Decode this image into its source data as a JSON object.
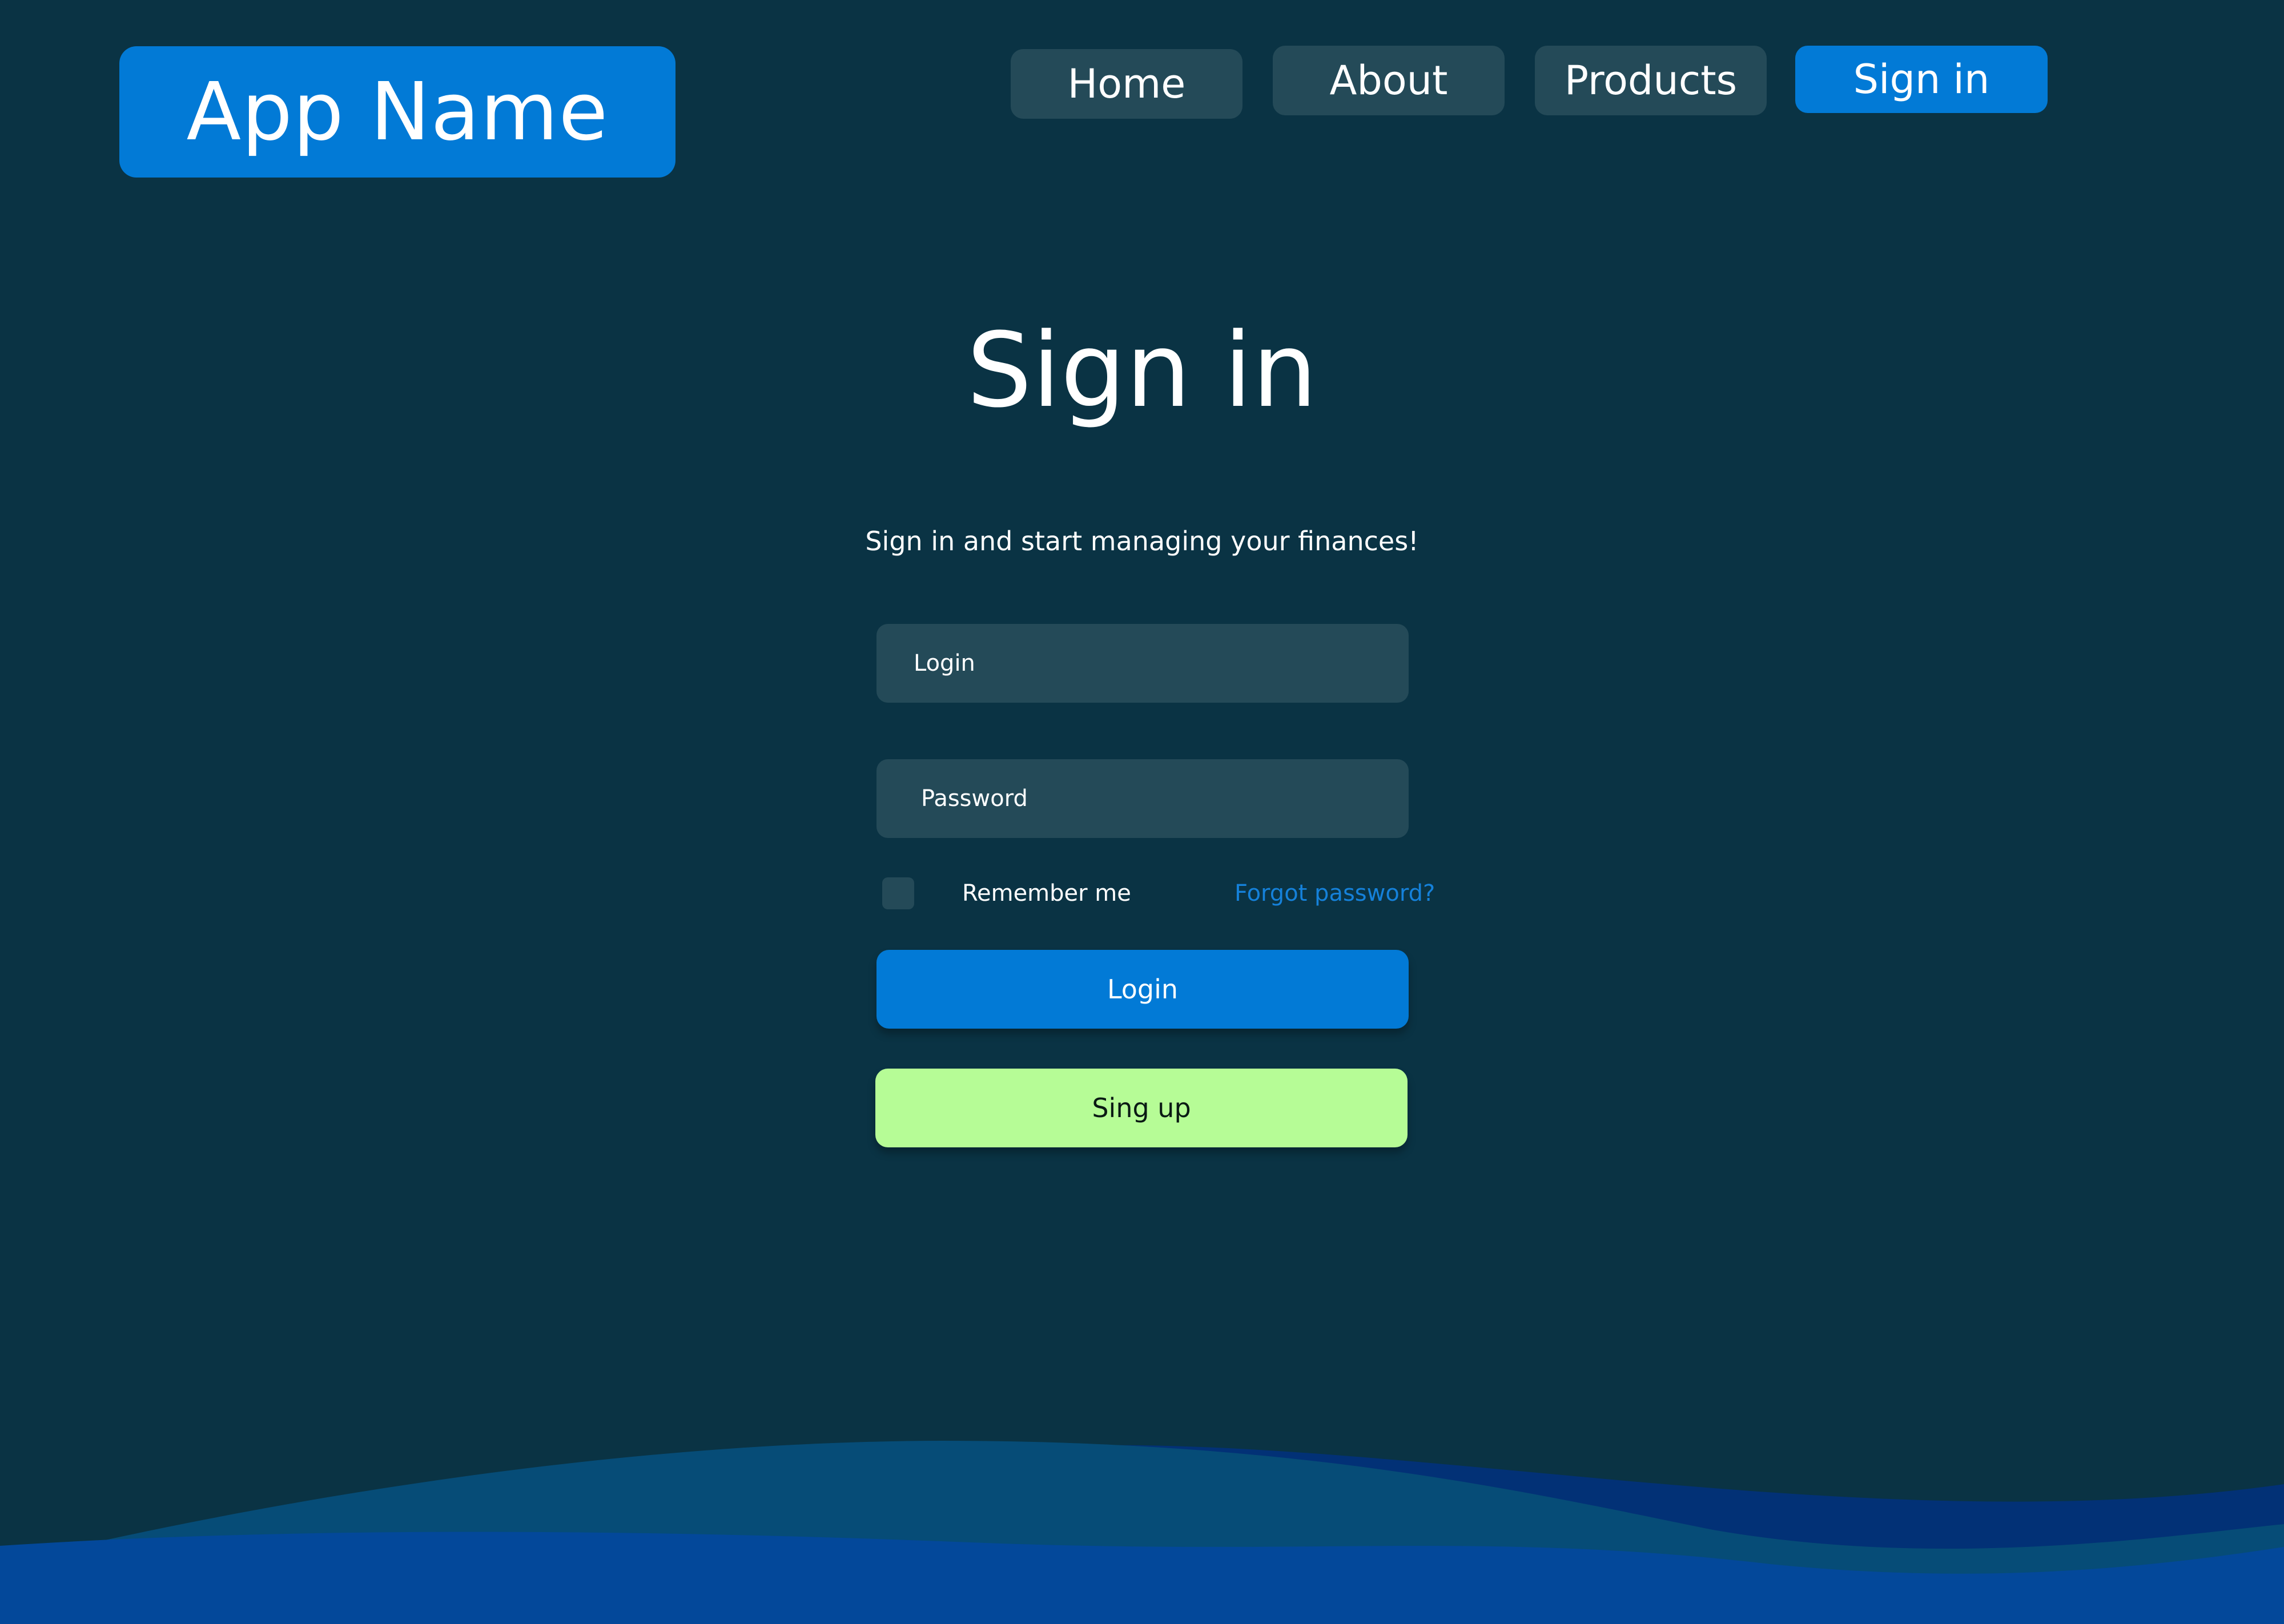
{
  "header": {
    "app_name": "App Name",
    "nav": {
      "home": "Home",
      "about": "About",
      "products": "Products",
      "sign_in": "Sign in"
    }
  },
  "main": {
    "title": "Sign in",
    "subtitle": "Sign in and start managing your finances!",
    "login_field": {
      "placeholder": "Login"
    },
    "password_field": {
      "placeholder": "Password"
    },
    "remember_me": {
      "label": "Remember me",
      "checked": false
    },
    "forgot_password": "Forgot password?",
    "login_button": "Login",
    "signup_button": "Sing up"
  },
  "colors": {
    "background": "#0a3344",
    "accent": "#027ad6",
    "field": "#244a58",
    "signup": "#b6fc96",
    "link": "#1581da"
  }
}
